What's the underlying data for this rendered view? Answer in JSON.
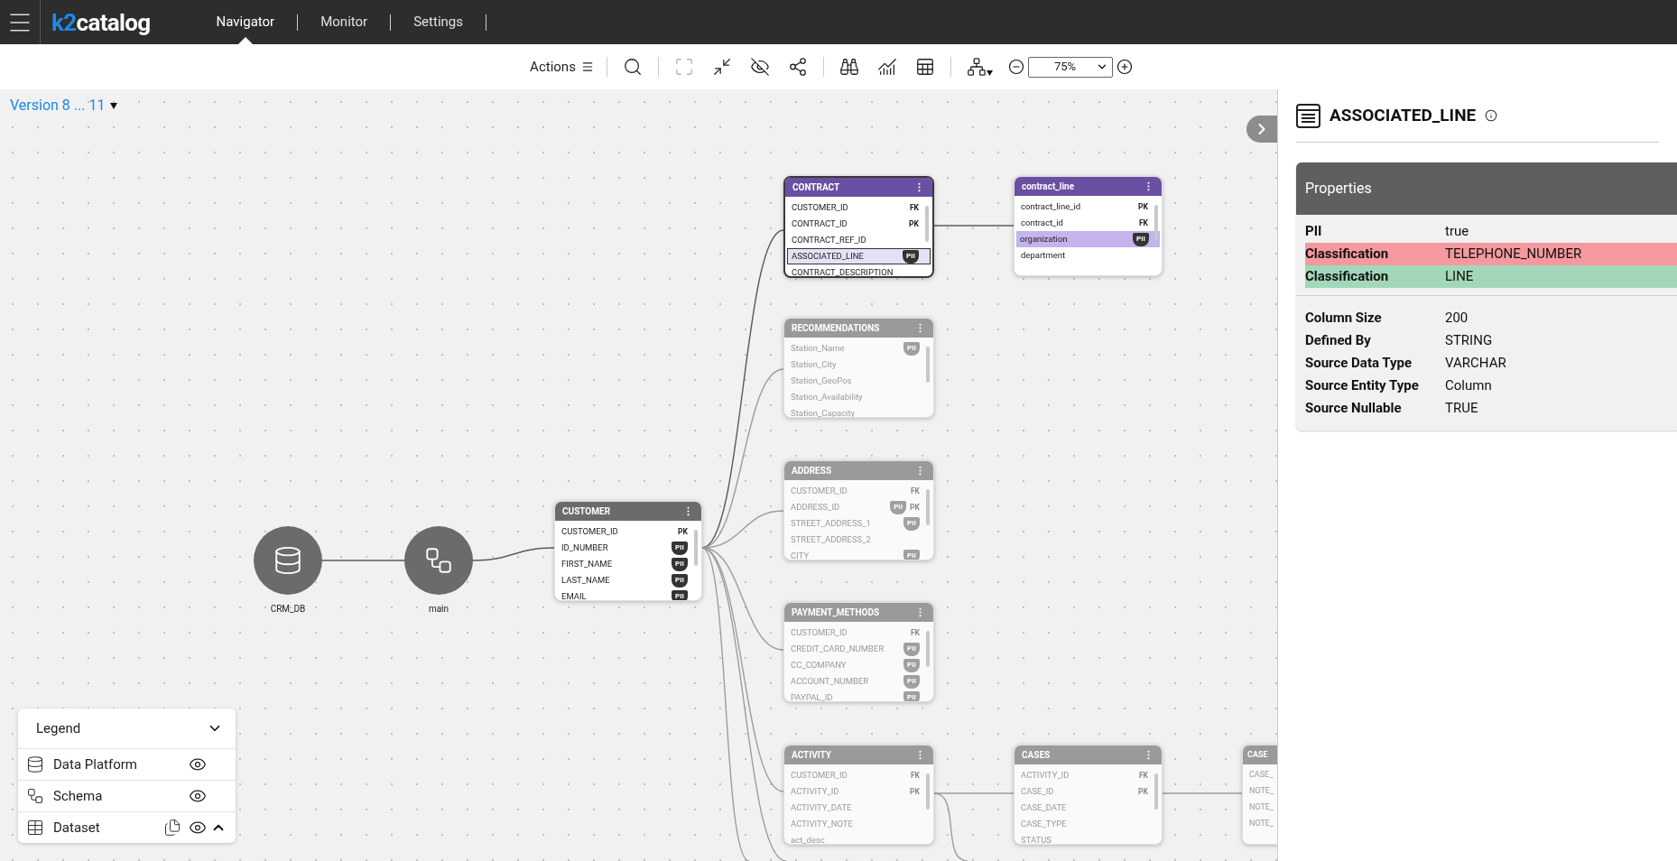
{
  "header": {
    "logo": {
      "mark": "k2",
      "word": "catalog"
    },
    "nav": [
      {
        "label": "Navigator",
        "selected": true
      },
      {
        "label": "Monitor",
        "selected": false
      },
      {
        "label": "Settings",
        "selected": false
      }
    ]
  },
  "toolbar": {
    "actions_label": "Actions",
    "groups": [
      [
        {
          "kind": "search",
          "disabled": false
        }
      ],
      [
        {
          "kind": "expand",
          "disabled": true
        },
        {
          "kind": "collapse",
          "disabled": false
        },
        {
          "kind": "hide",
          "disabled": false
        },
        {
          "kind": "graph",
          "disabled": false
        }
      ],
      [
        {
          "kind": "explore",
          "disabled": false
        },
        {
          "kind": "stats",
          "disabled": false
        },
        {
          "kind": "table-search",
          "disabled": false
        }
      ],
      [
        {
          "kind": "layout",
          "disabled": false
        }
      ]
    ],
    "zoom": {
      "value": "75%"
    }
  },
  "version": {
    "label": "Version 8 ... 11"
  },
  "nodes": [
    {
      "kind": "platform",
      "label": "CRM_DB"
    },
    {
      "kind": "schema",
      "label": "main"
    }
  ],
  "tables": [
    {
      "name": "CONTRACT",
      "kind": "focus",
      "selected": true,
      "rows": [
        {
          "name": "CUSTOMER_ID",
          "key": "FK",
          "selected": false
        },
        {
          "name": "CONTRACT_ID",
          "key": "PK",
          "selected": false
        },
        {
          "name": "CONTRACT_REF_ID",
          "selected": false
        },
        {
          "name": "ASSOCIATED_LINE",
          "pii": "PII",
          "selected": true
        },
        {
          "name": "CONTRACT_DESCRIPTION",
          "selected": false
        }
      ]
    },
    {
      "name": "contract_line",
      "kind": "focus",
      "selected": false,
      "rows": [
        {
          "name": "contract_line_id",
          "key": "PK",
          "selected": false
        },
        {
          "name": "contract_id",
          "key": "FK",
          "selected": false
        },
        {
          "name": "organization",
          "pii": "PII",
          "selected": true
        },
        {
          "name": "department",
          "selected": false
        }
      ]
    },
    {
      "name": "RECOMMENDATIONS",
      "kind": "dimmed",
      "selected": false,
      "rows": [
        {
          "name": "Station_Name",
          "pii": "PII",
          "selected": false
        },
        {
          "name": "Station_City",
          "selected": false
        },
        {
          "name": "Station_GeoPos",
          "selected": false
        },
        {
          "name": "Station_Availability",
          "selected": false
        },
        {
          "name": "Station_Capacity",
          "selected": false
        }
      ]
    },
    {
      "name": "ADDRESS",
      "kind": "dimmed",
      "selected": false,
      "rows": [
        {
          "name": "CUSTOMER_ID",
          "key": "FK",
          "selected": false
        },
        {
          "name": "ADDRESS_ID",
          "pii": "PII",
          "key": "PK",
          "selected": false
        },
        {
          "name": "STREET_ADDRESS_1",
          "pii": "PII",
          "selected": false
        },
        {
          "name": "STREET_ADDRESS_2",
          "selected": false
        },
        {
          "name": "CITY",
          "pii": "PII",
          "selected": false
        }
      ]
    },
    {
      "name": "CUSTOMER",
      "kind": "normal",
      "selected": false,
      "rows": [
        {
          "name": "CUSTOMER_ID",
          "key": "PK",
          "selected": false
        },
        {
          "name": "ID_NUMBER",
          "pii": "PII",
          "selected": false
        },
        {
          "name": "FIRST_NAME",
          "pii": "PII",
          "selected": false
        },
        {
          "name": "LAST_NAME",
          "pii": "PII",
          "selected": false
        },
        {
          "name": "EMAIL",
          "pii": "PII",
          "selected": false
        }
      ]
    },
    {
      "name": "PAYMENT_METHODS",
      "kind": "dimmed",
      "selected": false,
      "rows": [
        {
          "name": "CUSTOMER_ID",
          "key": "FK",
          "selected": false
        },
        {
          "name": "CREDIT_CARD_NUMBER",
          "pii": "PII",
          "selected": false
        },
        {
          "name": "CC_COMPANY",
          "pii": "PII",
          "selected": false
        },
        {
          "name": "ACCOUNT_NUMBER",
          "pii": "PII",
          "selected": false
        },
        {
          "name": "PAYPAL_ID",
          "pii": "PII",
          "selected": false
        }
      ]
    },
    {
      "name": "ACTIVITY",
      "kind": "dimmed",
      "selected": false,
      "rows": [
        {
          "name": "CUSTOMER_ID",
          "key": "FK",
          "selected": false
        },
        {
          "name": "ACTIVITY_ID",
          "key": "PK",
          "selected": false
        },
        {
          "name": "ACTIVITY_DATE",
          "selected": false
        },
        {
          "name": "ACTIVITY_NOTE",
          "selected": false
        },
        {
          "name": "act_desc",
          "selected": false
        }
      ]
    },
    {
      "name": "CASES",
      "kind": "dimmed",
      "selected": false,
      "rows": [
        {
          "name": "ACTIVITY_ID",
          "key": "FK",
          "selected": false
        },
        {
          "name": "CASE_ID",
          "key": "PK",
          "selected": false
        },
        {
          "name": "CASE_DATE",
          "selected": false
        },
        {
          "name": "CASE_TYPE",
          "selected": false
        },
        {
          "name": "STATUS",
          "selected": false
        }
      ]
    },
    {
      "name": "CASE",
      "kind": "dimmed",
      "selected": false,
      "rows": [
        {
          "name": "CASE_",
          "selected": false
        },
        {
          "name": "NOTE_",
          "selected": false
        },
        {
          "name": "NOTE_",
          "selected": false
        },
        {
          "name": "NOTE_",
          "selected": false
        }
      ]
    }
  ],
  "legend": {
    "title": "Legend",
    "items": [
      {
        "kind": "platform",
        "label": "Data Platform",
        "visible": true
      },
      {
        "kind": "schema",
        "label": "Schema",
        "visible": true
      },
      {
        "kind": "dataset",
        "label": "Dataset",
        "visible": true
      }
    ]
  },
  "panel": {
    "title": "ASSOCIATED_LINE",
    "card_title": "Properties",
    "groups": [
      [
        {
          "label": "PII",
          "value": "true"
        },
        {
          "label": "Classification",
          "value": "TELEPHONE_NUMBER",
          "color": "#f4999f"
        },
        {
          "label": "Classification",
          "value": "LINE",
          "color": "#a2d8b8"
        }
      ],
      [
        {
          "label": "Column Size",
          "value": "200"
        },
        {
          "label": "Defined By",
          "value": "STRING"
        },
        {
          "label": "Source Data Type",
          "value": "VARCHAR"
        },
        {
          "label": "Source Entity Type",
          "value": "Column"
        },
        {
          "label": "Source Nullable",
          "value": "TRUE"
        }
      ]
    ]
  }
}
